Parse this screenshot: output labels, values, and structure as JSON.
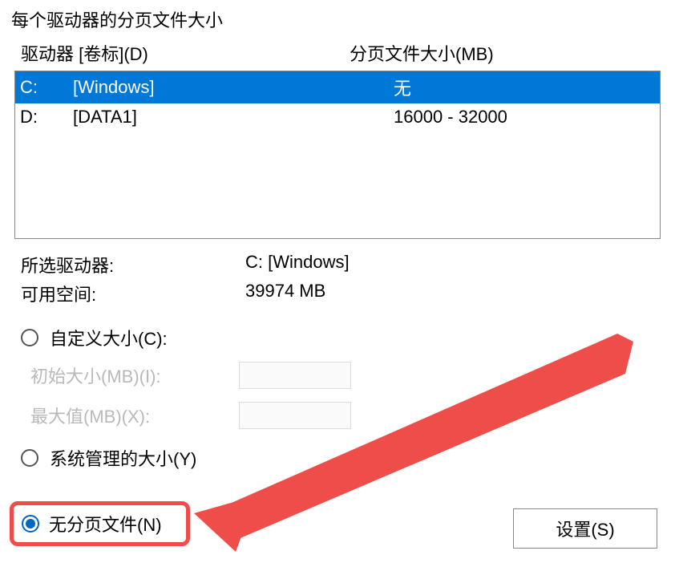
{
  "section_title": "每个驱动器的分页文件大小",
  "headers": {
    "drive": "驱动器 [卷标](D)",
    "size": "分页文件大小(MB)"
  },
  "drives": [
    {
      "letter": "C:",
      "label": "[Windows]",
      "value": "无",
      "selected": true
    },
    {
      "letter": "D:",
      "label": "[DATA1]",
      "value": "16000 - 32000",
      "selected": false
    }
  ],
  "info": {
    "selected_drive_label": "所选驱动器:",
    "selected_drive_value": "C:  [Windows]",
    "free_space_label": "可用空间:",
    "free_space_value": "39974 MB"
  },
  "options": {
    "custom_size": "自定义大小(C):",
    "initial_size": "初始大小(MB)(I):",
    "max_size": "最大值(MB)(X):",
    "system_managed": "系统管理的大小(Y)",
    "no_paging": "无分页文件(N)"
  },
  "set_button": "设置(S)",
  "annotation": {
    "highlight_color": "#ef4d4a"
  }
}
